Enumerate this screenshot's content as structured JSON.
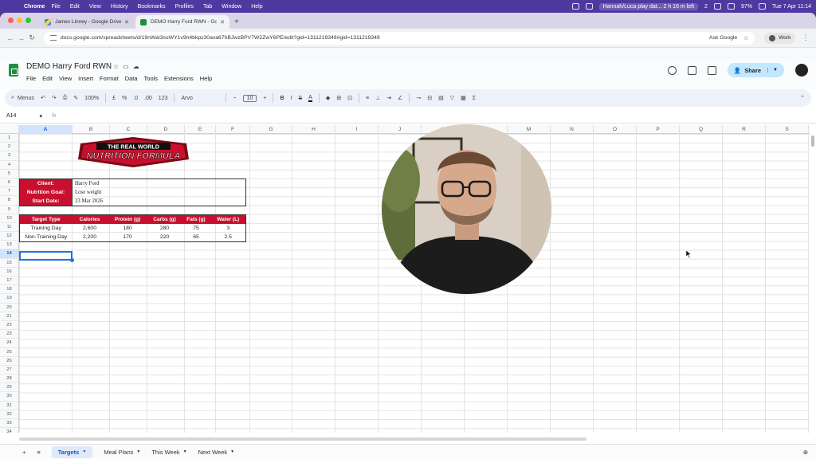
{
  "menubar": {
    "app": "Chrome",
    "items": [
      "File",
      "Edit",
      "View",
      "History",
      "Bookmarks",
      "Profiles",
      "Tab",
      "Window",
      "Help"
    ],
    "now_playing": "Hannah/Luca play dat... 2 h 16 m left",
    "counter": "2",
    "battery": "97%",
    "clock": "Tue 7 Apr 11:14"
  },
  "browser": {
    "tabs": [
      {
        "title": "James Linney - Google Drive",
        "favicon": "drive-icon"
      },
      {
        "title": "DEMO Harry Ford RWN - Goo",
        "favicon": "sheets-icon"
      }
    ],
    "url": "docs.google.com/spreadsheets/d/19nWaI3soWY1v9n4bkps30ava67hBJwzBPV7W2ZwY6PE/edit?gid=1311219349#gid=1311219349",
    "ask_google": "Ask Google",
    "profile": "Work"
  },
  "doc": {
    "title": "DEMO Harry Ford RWN",
    "menus": [
      "File",
      "Edit",
      "View",
      "Insert",
      "Format",
      "Data",
      "Tools",
      "Extensions",
      "Help"
    ],
    "share_label": "Share"
  },
  "format_toolbar": {
    "search_label": "Menus",
    "zoom": "100%",
    "currency": "£",
    "percent": "%",
    "dec_less": ".0",
    "dec_more": ".00",
    "num_format": "123",
    "font": "Arvo",
    "font_size": "10",
    "bold": "B",
    "italic": "I",
    "strike": "S",
    "text_color": "A",
    "sigma": "Σ"
  },
  "formula_bar": {
    "cell_ref": "A14",
    "fx": "fx"
  },
  "grid": {
    "columns": [
      "A",
      "B",
      "C",
      "D",
      "E",
      "F",
      "G",
      "H",
      "I",
      "J",
      "K",
      "L",
      "M",
      "N",
      "O",
      "P",
      "Q",
      "R",
      "S"
    ],
    "rows": [
      "1",
      "2",
      "3",
      "4",
      "5",
      "6",
      "7",
      "8",
      "9",
      "10",
      "11",
      "12",
      "13",
      "14",
      "15",
      "16",
      "17",
      "18",
      "19",
      "20",
      "21",
      "22",
      "23",
      "24",
      "25",
      "26",
      "27",
      "28",
      "29",
      "30",
      "31",
      "32",
      "33",
      "34"
    ],
    "selected_col": "A",
    "selected_row": "14"
  },
  "logo": {
    "line1": "THE REAL WORLD",
    "line2": "NUTRITION FORMULA"
  },
  "client": [
    {
      "label": "Client:",
      "value": "Harry Ford"
    },
    {
      "label": "Nutrition Goal:",
      "value": "Lose weight"
    },
    {
      "label": "Start Date:",
      "value": "23 Mar 2026"
    }
  ],
  "targets": {
    "headers": [
      "Target Type",
      "Calories",
      "Protein (g)",
      "Carbs (g)",
      "Fats (g)",
      "Water (L)"
    ],
    "rows": [
      [
        "Training Day",
        "2,600",
        "180",
        "280",
        "75",
        "3"
      ],
      [
        "Non-Training Day",
        "2,200",
        "170",
        "220",
        "65",
        "2.5"
      ]
    ]
  },
  "sheet_tabs": [
    "Targets",
    "Meal Plans",
    "This Week",
    "Next Week"
  ],
  "colors": {
    "brand_red": "#c8102e",
    "accent_blue": "#1a73e8",
    "menubar": "#4d3aa0"
  }
}
